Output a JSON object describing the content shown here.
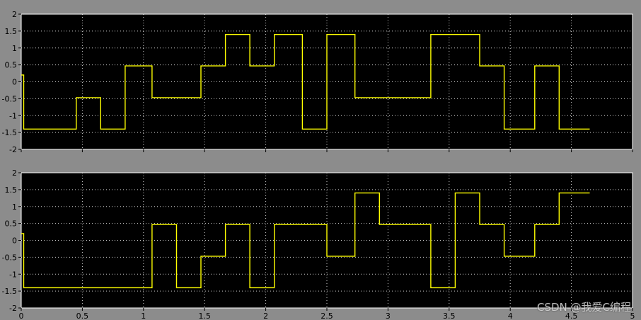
{
  "chart_data": [
    {
      "type": "line",
      "panel": "top",
      "title": "",
      "xlabel": "",
      "ylabel": "",
      "xlim": [
        0,
        5
      ],
      "ylim": [
        -2,
        2
      ],
      "yticks": [
        -2,
        -1.5,
        -1,
        -0.5,
        0,
        0.5,
        1,
        1.5,
        2
      ],
      "ytick_labels": [
        "-2",
        "-1.5",
        "-1",
        "-0.5",
        "0",
        "0.5",
        "1",
        "1.5",
        "2"
      ],
      "grid": "dotted",
      "colors": {
        "background": "#000000",
        "line": "#ffff00",
        "grid": "#ffffff"
      },
      "series": [
        {
          "x": [
            0,
            0.02,
            0.02,
            0.45,
            0.45,
            0.65,
            0.65,
            0.85,
            0.85,
            1.07,
            1.07,
            1.47,
            1.47,
            1.67,
            1.67,
            1.87,
            1.87,
            2.07,
            2.07,
            2.3,
            2.3,
            2.5,
            2.5,
            2.73,
            2.73,
            3.35,
            3.35,
            3.75,
            3.75,
            3.95,
            3.95,
            4.2,
            4.2,
            4.4,
            4.4,
            4.6,
            4.6,
            4.65
          ],
          "y": [
            0.2,
            0.2,
            -1.4,
            -1.4,
            -0.47,
            -0.47,
            -1.4,
            -1.4,
            0.47,
            0.47,
            -0.47,
            -0.47,
            0.47,
            0.47,
            1.4,
            1.4,
            0.47,
            0.47,
            1.4,
            1.4,
            -1.4,
            -1.4,
            1.4,
            1.4,
            -0.47,
            -0.47,
            1.4,
            1.4,
            0.47,
            0.47,
            -1.4,
            -1.4,
            0.47,
            0.47,
            -1.4,
            -1.4,
            -1.4,
            -1.4
          ]
        }
      ]
    },
    {
      "type": "line",
      "panel": "bottom",
      "title": "",
      "xlabel": "",
      "ylabel": "",
      "xlim": [
        0,
        5
      ],
      "ylim": [
        -2,
        2
      ],
      "xticks": [
        0,
        0.5,
        1,
        1.5,
        2,
        2.5,
        3,
        3.5,
        4,
        4.5,
        5
      ],
      "xtick_labels": [
        "0",
        "0.5",
        "1",
        "1.5",
        "2",
        "2.5",
        "3",
        "3.5",
        "4",
        "4.5",
        "5"
      ],
      "yticks": [
        -2,
        -1.5,
        -1,
        -0.5,
        0,
        0.5,
        1,
        1.5,
        2
      ],
      "ytick_labels": [
        "-2",
        "-1.5",
        "-1",
        "-0.5",
        "0",
        "0.5",
        "1",
        "1.5",
        "2"
      ],
      "grid": "dotted",
      "colors": {
        "background": "#000000",
        "line": "#ffff00",
        "grid": "#ffffff"
      },
      "series": [
        {
          "x": [
            0,
            0.02,
            0.02,
            1.07,
            1.07,
            1.27,
            1.27,
            1.47,
            1.47,
            1.67,
            1.67,
            1.87,
            1.87,
            2.07,
            2.07,
            2.3,
            2.3,
            2.5,
            2.5,
            2.73,
            2.73,
            2.93,
            2.93,
            3.35,
            3.35,
            3.55,
            3.55,
            3.75,
            3.75,
            3.95,
            3.95,
            4.2,
            4.2,
            4.4,
            4.4,
            4.6,
            4.6,
            4.65
          ],
          "y": [
            0.2,
            0.2,
            -1.4,
            -1.4,
            0.47,
            0.47,
            -1.4,
            -1.4,
            -0.47,
            -0.47,
            0.47,
            0.47,
            -1.4,
            -1.4,
            0.47,
            0.47,
            0.47,
            0.47,
            -0.47,
            -0.47,
            1.4,
            1.4,
            0.47,
            0.47,
            -1.4,
            -1.4,
            1.4,
            1.4,
            0.47,
            0.47,
            -0.47,
            -0.47,
            0.47,
            0.47,
            1.4,
            1.4,
            1.4,
            1.4
          ]
        }
      ]
    }
  ],
  "watermark": "CSDN @我爱C编程"
}
